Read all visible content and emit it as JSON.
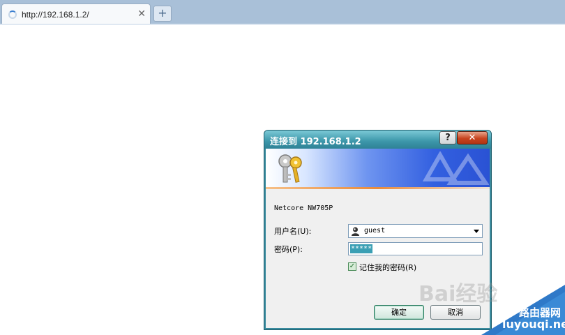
{
  "browser": {
    "tab_title": "http://192.168.1.2/",
    "tab_close": "✕",
    "new_tab": "+"
  },
  "dialog": {
    "title": "连接到 192.168.1.2",
    "help_button": "?",
    "close_button": "✕",
    "device_name": "Netcore NW705P",
    "username_label": "用户名(U):",
    "username_value": "guest",
    "password_label": "密码(P):",
    "password_value": "*****",
    "remember_label": "记住我的密码(R)",
    "remember_checked": true,
    "ok_label": "确定",
    "cancel_label": "取消"
  },
  "watermarks": {
    "baidu": "Bai经验",
    "site_cn": "路由器网",
    "site_en": "luyouqi.net"
  },
  "colors": {
    "titlebar": "#3c96a9",
    "selection": "#3a9fb4",
    "banner_blue": "#3360e0"
  }
}
